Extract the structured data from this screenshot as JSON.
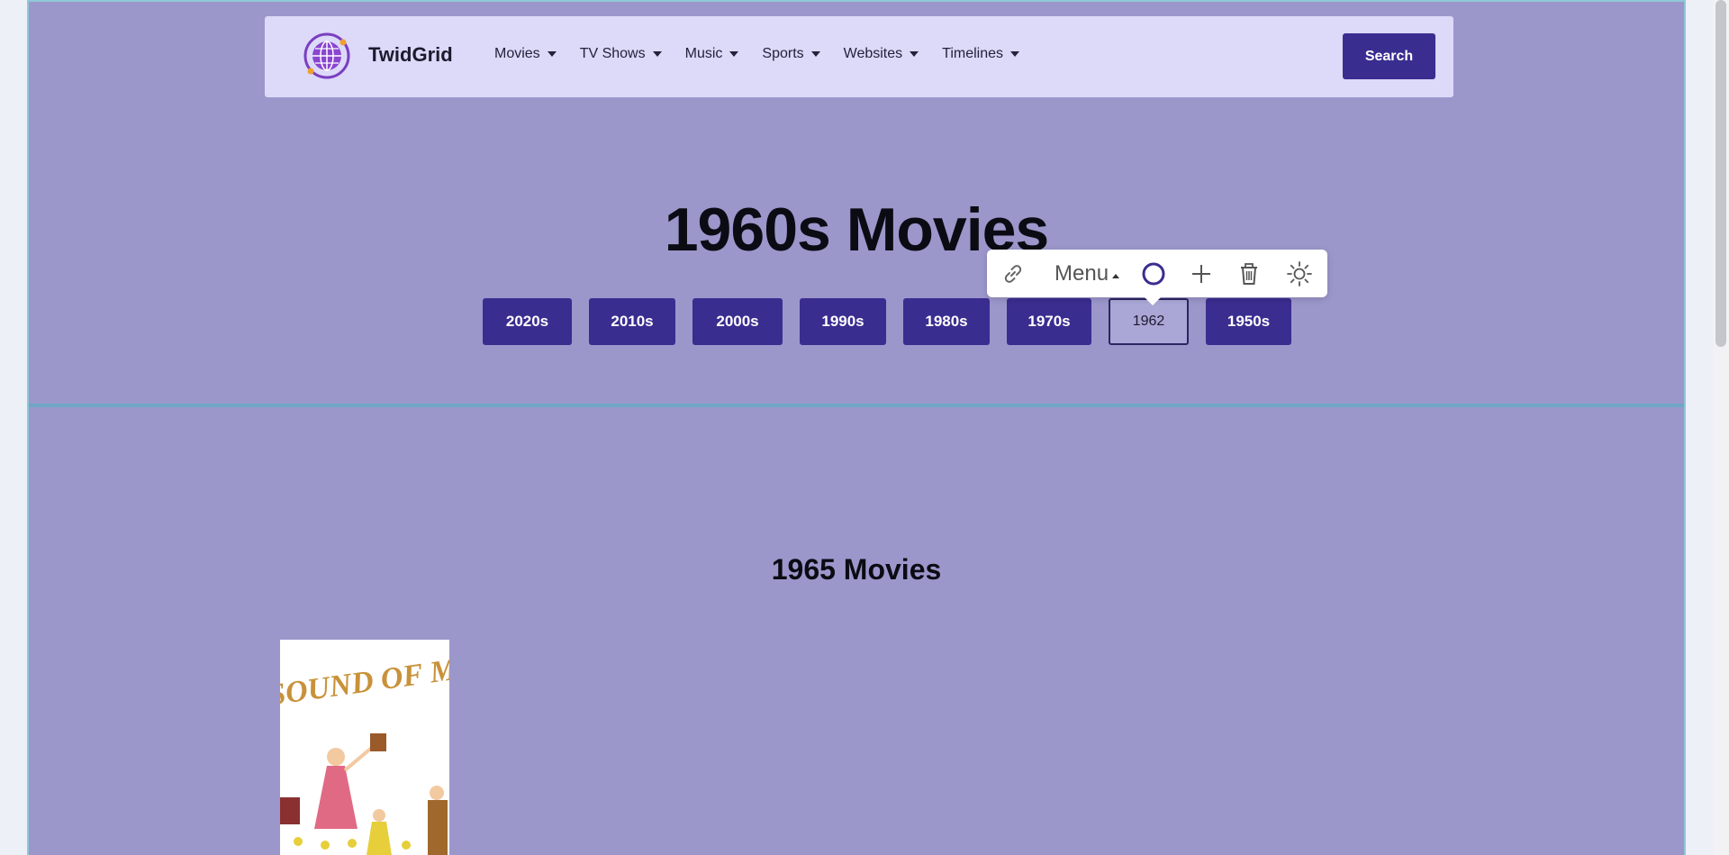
{
  "brand": {
    "name": "TwidGrid"
  },
  "nav": {
    "items": [
      {
        "label": "Movies"
      },
      {
        "label": "TV Shows"
      },
      {
        "label": "Music"
      },
      {
        "label": "Sports"
      },
      {
        "label": "Websites"
      },
      {
        "label": "Timelines"
      }
    ]
  },
  "search": {
    "label": "Search"
  },
  "page_title": "1960s Movies",
  "decades": {
    "before": [
      "2020s",
      "2010s",
      "2000s",
      "1990s",
      "1980s",
      "1970s"
    ],
    "editing_value": "1962",
    "after": [
      "1950s"
    ]
  },
  "toolbar": {
    "menu_label": "Menu",
    "icons": [
      "link-icon",
      "circle-icon",
      "plus-icon",
      "trash-icon",
      "sun-icon"
    ],
    "accent_color": "#3a2d90"
  },
  "section": {
    "title": "1965 Movies",
    "poster_title": "THE SOUND OF MUSIC"
  },
  "colors": {
    "background": "#9b97cb",
    "header": "#dcd9f9",
    "button": "#3a2d90"
  }
}
